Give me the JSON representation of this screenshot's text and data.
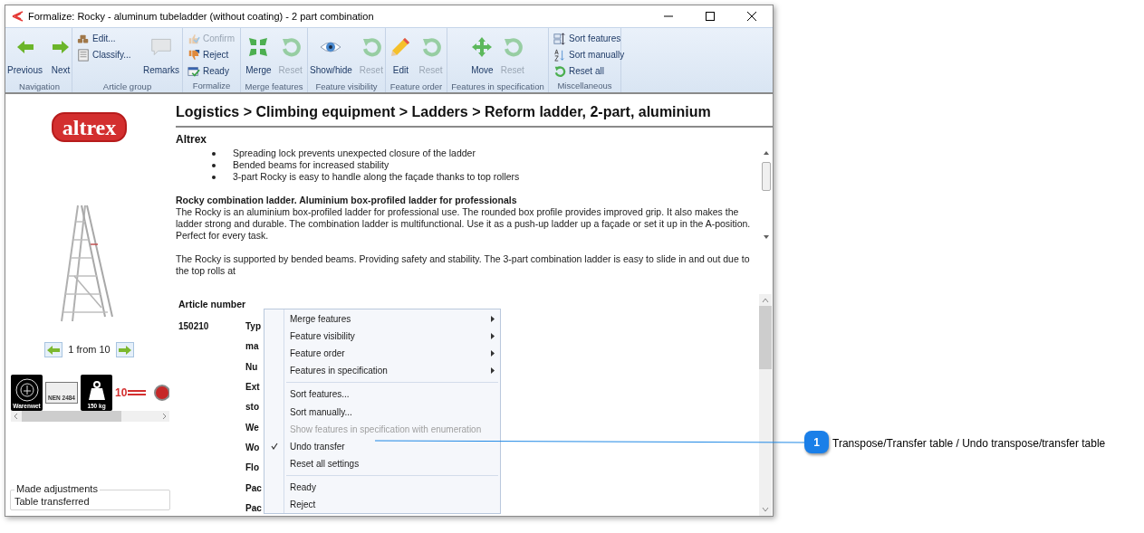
{
  "window": {
    "title": "Formalize: Rocky - aluminum tubeladder (without coating) - 2 part combination"
  },
  "ribbon": {
    "groups": [
      {
        "label": "Navigation",
        "buttons": [
          {
            "kind": "large",
            "label": "Previous",
            "disabled": false
          },
          {
            "kind": "large",
            "label": "Next",
            "disabled": false
          }
        ]
      },
      {
        "label": "Article group",
        "buttons": [
          {
            "kind": "small",
            "label": "Edit...",
            "disabled": false
          },
          {
            "kind": "small",
            "label": "Classify...",
            "disabled": false
          },
          {
            "kind": "large",
            "label": "Remarks",
            "disabled": false
          }
        ]
      },
      {
        "label": "Formalize",
        "buttons": [
          {
            "kind": "small",
            "label": "Confirm",
            "disabled": true
          },
          {
            "kind": "small",
            "label": "Reject",
            "disabled": false
          },
          {
            "kind": "small",
            "label": "Ready",
            "disabled": false
          }
        ]
      },
      {
        "label": "Merge features",
        "buttons": [
          {
            "kind": "large",
            "label": "Merge",
            "disabled": false
          },
          {
            "kind": "large",
            "label": "Reset",
            "disabled": true
          }
        ]
      },
      {
        "label": "Feature visibility",
        "buttons": [
          {
            "kind": "large",
            "label": "Show/hide",
            "disabled": false
          },
          {
            "kind": "large",
            "label": "Reset",
            "disabled": true
          }
        ]
      },
      {
        "label": "Feature order",
        "buttons": [
          {
            "kind": "large",
            "label": "Edit",
            "disabled": false
          },
          {
            "kind": "large",
            "label": "Reset",
            "disabled": true
          }
        ]
      },
      {
        "label": "Features in specification",
        "buttons": [
          {
            "kind": "large",
            "label": "Move",
            "disabled": false
          },
          {
            "kind": "large",
            "label": "Reset",
            "disabled": true
          }
        ]
      },
      {
        "label": "Miscellaneous",
        "buttons": [
          {
            "kind": "small",
            "label": "Sort features",
            "disabled": false
          },
          {
            "kind": "small",
            "label": "Sort manually",
            "disabled": false
          },
          {
            "kind": "small",
            "label": "Reset all",
            "disabled": false
          }
        ]
      }
    ]
  },
  "left_panel": {
    "logo": "altrex",
    "pager": "1 from 10",
    "badges": [
      {
        "kind": "seal",
        "text": "Warenwet"
      },
      {
        "kind": "norm",
        "text": "NEN 2484"
      },
      {
        "kind": "load",
        "text": "150 kg"
      },
      {
        "kind": "guarantee",
        "text": "10"
      },
      {
        "kind": "emblem"
      }
    ],
    "adjustments": {
      "legend": "Made adjustments",
      "value": "Table transferred"
    }
  },
  "content": {
    "breadcrumb": "Logistics > Climbing equipment > Ladders > Reform ladder, 2-part, aluminium",
    "brand": "Altrex",
    "bullets": [
      "Spreading lock prevents unexpected closure of the ladder",
      "Bended beams for increased stability",
      "3-part Rocky is easy to handle along the façade thanks to top rollers"
    ],
    "description_title": "Rocky combination ladder. Aluminium box-profiled ladder for professionals",
    "paragraphs": [
      "The Rocky is an aluminium box-profiled ladder for professional use. The rounded box profile provides improved grip. It also makes the ladder strong and durable. The combination ladder is multifunctional. Use it as a push-up ladder up a façade or set it up in the A-position. Perfect for every task.",
      "The Rocky is supported by bended beams. Providing safety and stability. The 3-part combination ladder is easy to slide in and out due to the top rolls at"
    ],
    "table": {
      "header": "Article number",
      "article": "150210",
      "row_labels": [
        "Typ",
        "ma",
        "Nu",
        "Ext",
        "sto",
        "We",
        "Wo",
        "Flo",
        "Pac",
        "Pac"
      ]
    }
  },
  "context_menu": [
    {
      "kind": "submenu",
      "label": "Merge features",
      "checked": false,
      "disabled": false
    },
    {
      "kind": "submenu",
      "label": "Feature visibility",
      "checked": false,
      "disabled": false
    },
    {
      "kind": "submenu",
      "label": "Feature order",
      "checked": false,
      "disabled": false
    },
    {
      "kind": "submenu",
      "label": "Features in specification",
      "checked": false,
      "disabled": false
    },
    {
      "kind": "separator"
    },
    {
      "kind": "item",
      "label": "Sort features...",
      "checked": false,
      "disabled": false
    },
    {
      "kind": "item",
      "label": "Sort manually...",
      "checked": false,
      "disabled": false
    },
    {
      "kind": "item",
      "label": "Show features in specification with enumeration",
      "checked": false,
      "disabled": true
    },
    {
      "kind": "item",
      "label": "Undo transfer",
      "checked": true,
      "disabled": false
    },
    {
      "kind": "item",
      "label": "Reset all settings",
      "checked": false,
      "disabled": false
    },
    {
      "kind": "separator"
    },
    {
      "kind": "item",
      "label": "Ready",
      "checked": false,
      "disabled": false
    },
    {
      "kind": "item",
      "label": "Reject",
      "checked": false,
      "disabled": false
    }
  ],
  "callout": {
    "number": "1",
    "text": "Transpose/Transfer table / Undo transpose/transfer table"
  }
}
